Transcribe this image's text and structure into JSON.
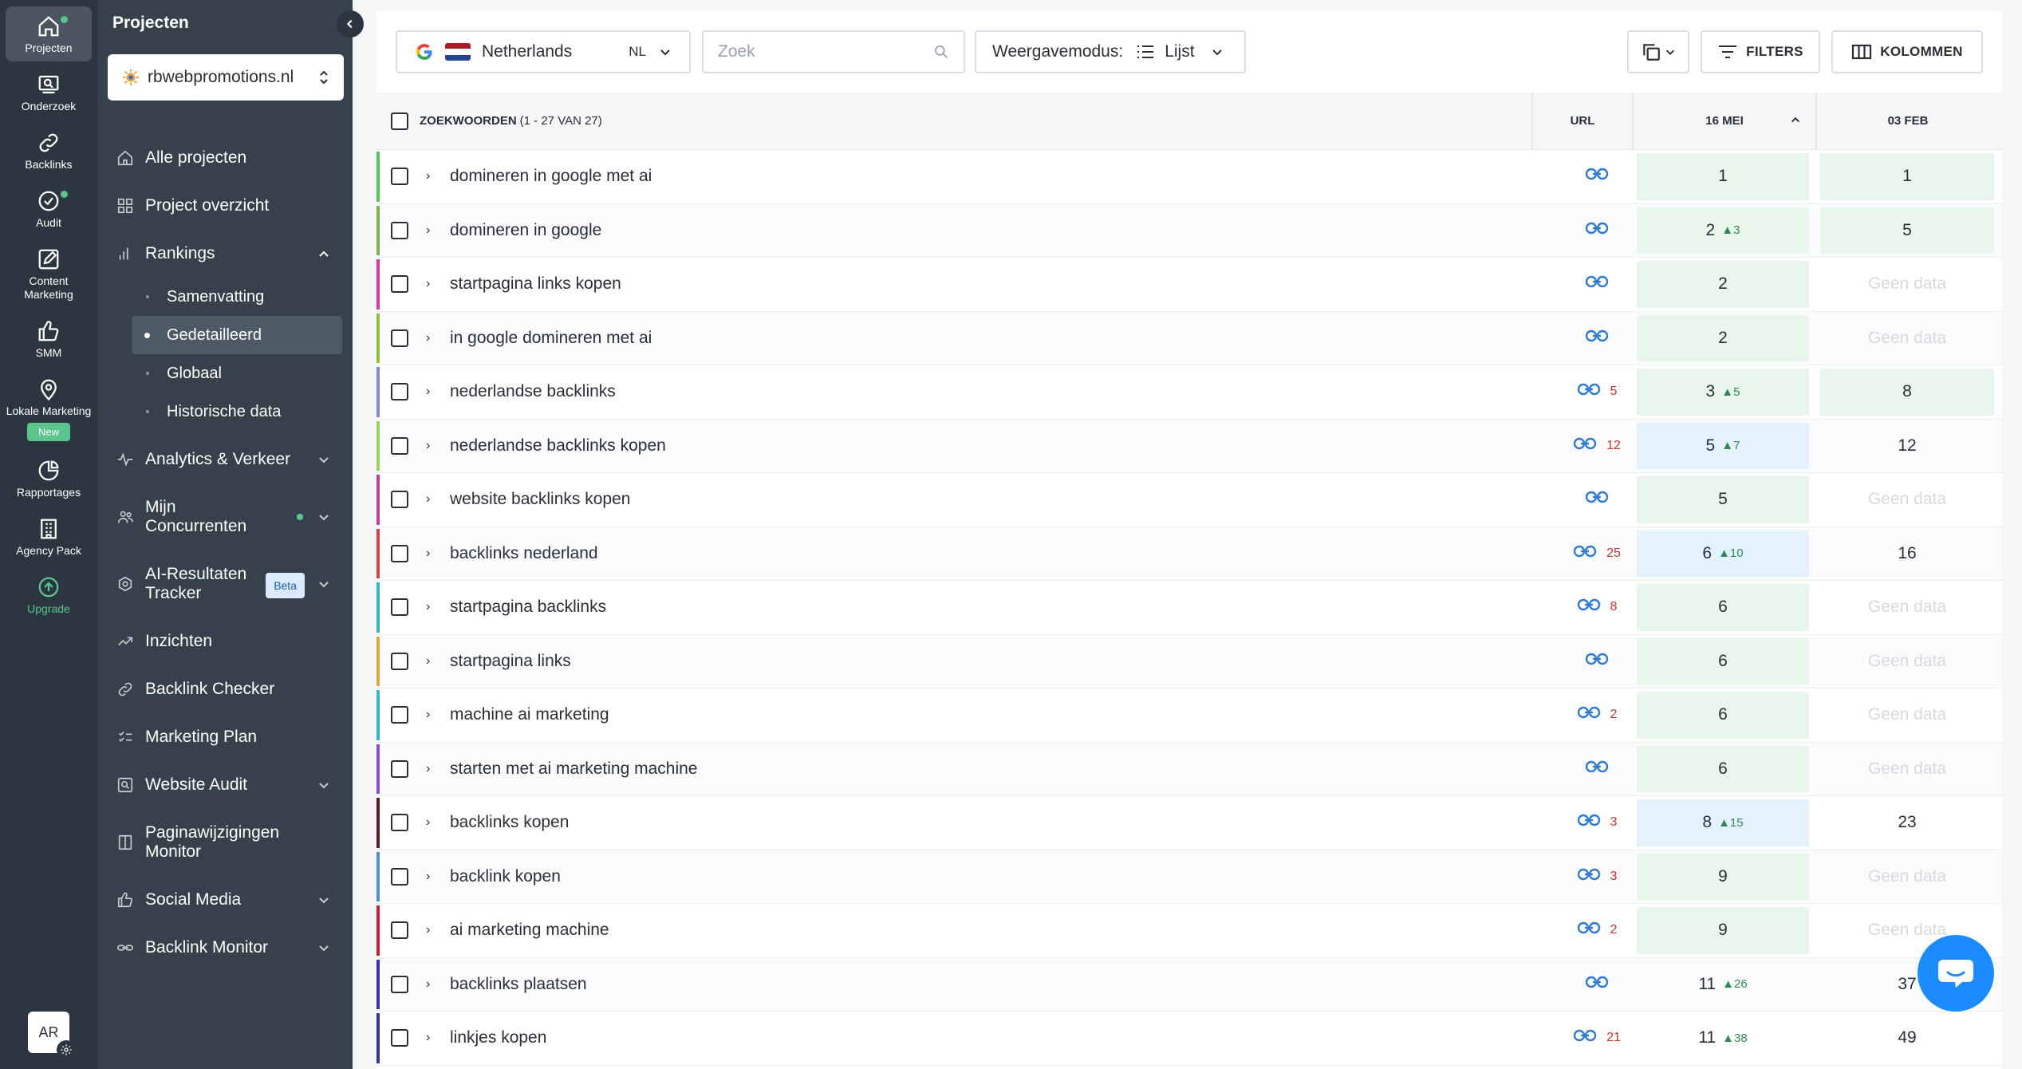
{
  "rail": {
    "items": [
      {
        "label": "Projecten",
        "icon": "home-icon",
        "active": true,
        "dot": true
      },
      {
        "label": "Onderzoek",
        "icon": "research-icon"
      },
      {
        "label": "Backlinks",
        "icon": "link-icon"
      },
      {
        "label": "Audit",
        "icon": "audit-icon",
        "dot": true
      },
      {
        "label": "Content Marketing",
        "icon": "edit-icon"
      },
      {
        "label": "SMM",
        "icon": "thumbs-up-icon"
      },
      {
        "label": "Lokale Marketing",
        "icon": "location-icon",
        "badge": "New"
      },
      {
        "label": "Rapportages",
        "icon": "report-icon"
      },
      {
        "label": "Agency Pack",
        "icon": "building-icon"
      },
      {
        "label": "Upgrade",
        "icon": "upgrade-icon"
      }
    ],
    "avatar": "AR"
  },
  "sidebar": {
    "title": "Projecten",
    "project": "rbwebpromotions.nl",
    "nav": [
      {
        "label": "Alle projecten"
      },
      {
        "label": "Project overzicht"
      },
      {
        "label": "Rankings",
        "expanded": true
      }
    ],
    "sub": [
      {
        "label": "Samenvatting"
      },
      {
        "label": "Gedetailleerd",
        "active": true
      },
      {
        "label": "Globaal"
      },
      {
        "label": "Historische data"
      }
    ],
    "nav2": [
      {
        "label": "Analytics & Verkeer"
      },
      {
        "label": "Mijn Concurrenten"
      },
      {
        "label": "AI-Resultaten Tracker",
        "badge": "Beta"
      },
      {
        "label": "Inzichten"
      },
      {
        "label": "Backlink Checker"
      },
      {
        "label": "Marketing Plan"
      },
      {
        "label": "Website Audit"
      },
      {
        "label": "Paginawijzigingen Monitor"
      },
      {
        "label": "Social Media"
      },
      {
        "label": "Backlink Monitor"
      }
    ]
  },
  "toolbar": {
    "country": "Netherlands",
    "country_code": "NL",
    "search_placeholder": "Zoek",
    "viewmode_label": "Weergavemodus:",
    "viewmode_value": "Lijst",
    "filters_label": "FILTERS",
    "columns_label": "KOLOMMEN"
  },
  "table": {
    "header_keywords": "ZOEKWOORDEN",
    "header_count": "(1 - 27 VAN 27)",
    "header_url": "URL",
    "header_date1": "16 MEI",
    "header_date2": "03 FEB",
    "rows": [
      {
        "kw": "domineren in google met ai",
        "url_count": "",
        "d1": "1",
        "d1_up": "",
        "d1_style": "green",
        "d2": "1",
        "d2_style": "green",
        "strip": "#5bc45b"
      },
      {
        "kw": "domineren in google",
        "url_count": "",
        "d1": "2",
        "d1_up": "3",
        "d1_style": "green",
        "d2": "5",
        "d2_style": "green",
        "strip": "#7ab648"
      },
      {
        "kw": "startpagina links kopen",
        "url_count": "",
        "d1": "2",
        "d1_up": "",
        "d1_style": "green",
        "d2": "Geen data",
        "d2_style": "nodata",
        "strip": "#d93aa0"
      },
      {
        "kw": "in google domineren met ai",
        "url_count": "",
        "d1": "2",
        "d1_up": "",
        "d1_style": "green",
        "d2": "Geen data",
        "d2_style": "nodata",
        "strip": "#8cbf3f"
      },
      {
        "kw": "nederlandse backlinks",
        "url_count": "5",
        "d1": "3",
        "d1_up": "5",
        "d1_style": "green",
        "d2": "8",
        "d2_style": "green",
        "strip": "#7d8bd6"
      },
      {
        "kw": "nederlandse backlinks kopen",
        "url_count": "12",
        "d1": "5",
        "d1_up": "7",
        "d1_style": "blue",
        "d2": "12",
        "d2_style": "plain",
        "strip": "#9bd65b"
      },
      {
        "kw": "website backlinks kopen",
        "url_count": "",
        "d1": "5",
        "d1_up": "",
        "d1_style": "green",
        "d2": "Geen data",
        "d2_style": "nodata",
        "strip": "#c23d9a"
      },
      {
        "kw": "backlinks nederland",
        "url_count": "25",
        "d1": "6",
        "d1_up": "10",
        "d1_style": "blue",
        "d2": "16",
        "d2_style": "plain",
        "strip": "#d64545"
      },
      {
        "kw": "startpagina backlinks",
        "url_count": "8",
        "d1": "6",
        "d1_up": "",
        "d1_style": "green",
        "d2": "Geen data",
        "d2_style": "nodata",
        "strip": "#39b5c9"
      },
      {
        "kw": "startpagina links",
        "url_count": "",
        "d1": "6",
        "d1_up": "",
        "d1_style": "green",
        "d2": "Geen data",
        "d2_style": "nodata",
        "strip": "#e0a93b"
      },
      {
        "kw": "machine ai marketing",
        "url_count": "2",
        "d1": "6",
        "d1_up": "",
        "d1_style": "green",
        "d2": "Geen data",
        "d2_style": "nodata",
        "strip": "#36b6d6"
      },
      {
        "kw": "starten met ai marketing machine",
        "url_count": "",
        "d1": "6",
        "d1_up": "",
        "d1_style": "green",
        "d2": "Geen data",
        "d2_style": "nodata",
        "strip": "#8c4fc9"
      },
      {
        "kw": "backlinks kopen",
        "url_count": "3",
        "d1": "8",
        "d1_up": "15",
        "d1_style": "blue",
        "d2": "23",
        "d2_style": "plain",
        "strip": "#5a1f2a"
      },
      {
        "kw": "backlink kopen",
        "url_count": "3",
        "d1": "9",
        "d1_up": "",
        "d1_style": "green",
        "d2": "Geen data",
        "d2_style": "nodata",
        "strip": "#4f8fd6"
      },
      {
        "kw": "ai marketing machine",
        "url_count": "2",
        "d1": "9",
        "d1_up": "",
        "d1_style": "green",
        "d2": "Geen data",
        "d2_style": "nodata",
        "strip": "#c21f3a"
      },
      {
        "kw": "backlinks plaatsen",
        "url_count": "",
        "d1": "11",
        "d1_up": "26",
        "d1_style": "plain",
        "d2": "37",
        "d2_style": "plain",
        "strip": "#3a2fb0"
      },
      {
        "kw": "linkjes kopen",
        "url_count": "21",
        "d1": "11",
        "d1_up": "38",
        "d1_style": "plain",
        "d2": "49",
        "d2_style": "plain",
        "strip": "#2c3a9a"
      }
    ]
  },
  "colors": {
    "rail_bg": "#2c3640",
    "sidebar_bg": "#37414c",
    "accent_green": "#5bc48d",
    "cell_green": "#e8f6ec",
    "cell_blue": "#e3f2fc",
    "link_blue": "#2f7bd6",
    "count_red": "#d0312d",
    "chat_blue": "#1a8cff"
  }
}
